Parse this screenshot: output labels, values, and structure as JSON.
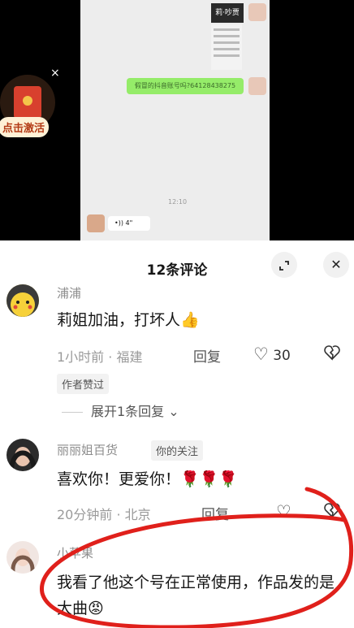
{
  "video": {
    "thumb_caption": "莉·吵贾",
    "bubble_text": "假冒的抖音账号吗?64128438275",
    "chat_time": "12:10",
    "voice_duration": "4\""
  },
  "redpacket": {
    "label": "点击激活"
  },
  "sheet": {
    "title": "12条评论"
  },
  "comments": [
    {
      "name": "浦浦",
      "text": "莉姐加油，打坏人👍",
      "time_loc": "1小时前 · 福建",
      "reply": "回复",
      "likes": "30",
      "tag": "作者赞过",
      "expand": "展开1条回复"
    },
    {
      "name": "丽丽姐百货",
      "badge": "你的关注",
      "text": "喜欢你！更爱你！🌹🌹🌹",
      "time_loc": "20分钟前 · 北京",
      "reply": "回复"
    },
    {
      "name": "小苹果",
      "text": "我看了他这个号在正常使用，作品发的是大曲😡"
    }
  ],
  "colors": {
    "scribble": "#e0201b",
    "chat_bubble": "#95ec69",
    "redpack": "#d8402e"
  },
  "icons": [
    "collapse-icon",
    "close-icon",
    "heart-icon",
    "broken-heart-icon",
    "chevron-down-icon"
  ]
}
